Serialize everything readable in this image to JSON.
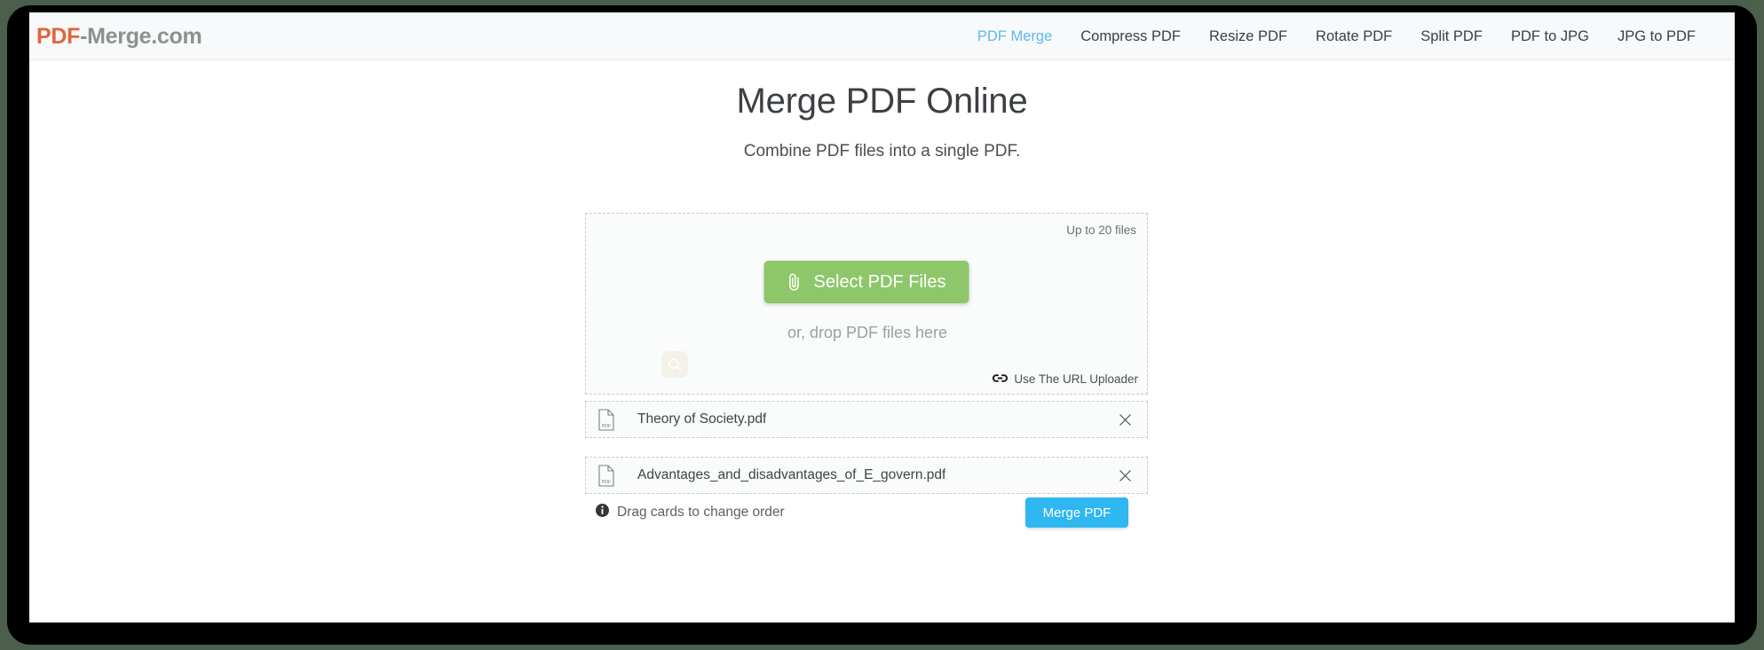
{
  "brand": {
    "logo_primary": "PDF",
    "logo_secondary": "-Merge.com",
    "primary_color": "#e2643c",
    "secondary_color": "#8d9190"
  },
  "nav": {
    "items": [
      {
        "label": "PDF Merge",
        "active": true
      },
      {
        "label": "Compress PDF",
        "active": false
      },
      {
        "label": "Resize PDF",
        "active": false
      },
      {
        "label": "Rotate PDF",
        "active": false
      },
      {
        "label": "Split PDF",
        "active": false
      },
      {
        "label": "PDF to JPG",
        "active": false
      },
      {
        "label": "JPG to PDF",
        "active": false
      }
    ],
    "active_color": "#5db8ef"
  },
  "main": {
    "title": "Merge PDF Online",
    "subtitle": "Combine PDF files into a single PDF."
  },
  "uploader": {
    "file_limit": "Up to 20 files",
    "select_button": "Select PDF Files",
    "select_button_color": "#8ec76a",
    "select_button_icon": "paperclip-icon",
    "drop_hint": "or, drop PDF files here",
    "url_uploader": "Use The URL Uploader",
    "url_uploader_icon": "link-icon",
    "search_badge_icon": "search-icon"
  },
  "files": {
    "items": [
      {
        "name": "Theory of Society.pdf",
        "icon": "pdf-file-icon",
        "remove_icon": "close-icon"
      },
      {
        "name": "Advantages_and_disadvantages_of_E_govern.pdf",
        "icon": "pdf-file-icon",
        "remove_icon": "close-icon"
      }
    ]
  },
  "footer": {
    "drag_hint": "Drag cards to change order",
    "drag_hint_icon": "info-icon",
    "merge_button": "Merge PDF",
    "merge_button_color": "#2fb7f1"
  }
}
